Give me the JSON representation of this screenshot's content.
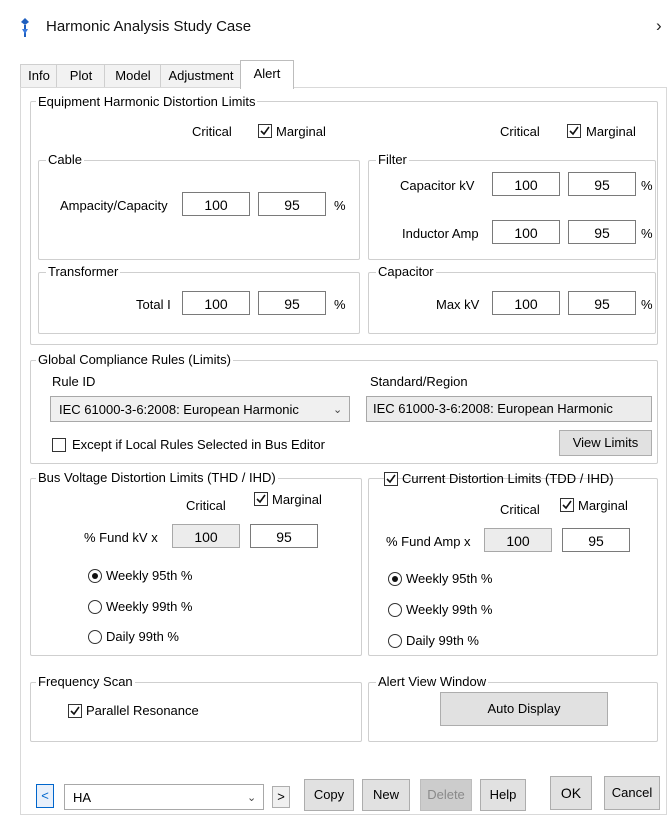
{
  "window": {
    "title": "Harmonic Analysis Study Case",
    "close_glyph": "›"
  },
  "tabs": [
    {
      "label": "Info"
    },
    {
      "label": "Plot"
    },
    {
      "label": "Model"
    },
    {
      "label": "Adjustment"
    },
    {
      "label": "Alert",
      "active": true
    }
  ],
  "equipment": {
    "legend": "Equipment Harmonic Distortion Limits",
    "critical_label": "Critical",
    "marginal_label": "Marginal",
    "marginal_checked": true,
    "cable": {
      "legend": "Cable",
      "rows": [
        {
          "label": "Ampacity/Capacity",
          "critical": "100",
          "marginal": "95",
          "unit": "%"
        }
      ]
    },
    "filter": {
      "legend": "Filter",
      "rows": [
        {
          "label": "Capacitor kV",
          "critical": "100",
          "marginal": "95",
          "unit": "%"
        },
        {
          "label": "Inductor Amp",
          "critical": "100",
          "marginal": "95",
          "unit": "%"
        }
      ]
    },
    "transformer": {
      "legend": "Transformer",
      "rows": [
        {
          "label": "Total I",
          "critical": "100",
          "marginal": "95",
          "unit": "%"
        }
      ]
    },
    "capacitor": {
      "legend": "Capacitor",
      "rows": [
        {
          "label": "Max kV",
          "critical": "100",
          "marginal": "95",
          "unit": "%"
        }
      ]
    }
  },
  "global": {
    "legend": "Global Compliance Rules (Limits)",
    "rule_id_label": "Rule ID",
    "rule_id_value": "IEC 61000-3-6:2008: European Harmonic",
    "standard_label": "Standard/Region",
    "standard_value": "IEC 61000-3-6:2008: European Harmonic",
    "except_label": "Except if Local Rules Selected in Bus Editor",
    "except_checked": false,
    "view_limits_label": "View Limits"
  },
  "bus_voltage": {
    "legend": "Bus Voltage Distortion Limits (THD / IHD)",
    "critical_label": "Critical",
    "marginal_label": "Marginal",
    "marginal_checked": true,
    "fund_label": "% Fund kV x",
    "critical_value": "100",
    "marginal_value": "95",
    "options": [
      {
        "label": "Weekly 95th %",
        "selected": true
      },
      {
        "label": "Weekly 99th %",
        "selected": false
      },
      {
        "label": "Daily 99th %",
        "selected": false
      }
    ]
  },
  "current": {
    "legend": "Current Distortion Limits (TDD / IHD)",
    "enabled_checked": true,
    "critical_label": "Critical",
    "marginal_label": "Marginal",
    "marginal_checked": true,
    "fund_label": "% Fund Amp x",
    "critical_value": "100",
    "marginal_value": "95",
    "options": [
      {
        "label": "Weekly 95th %",
        "selected": true
      },
      {
        "label": "Weekly 99th %",
        "selected": false
      },
      {
        "label": "Daily 99th %",
        "selected": false
      }
    ]
  },
  "frequency_scan": {
    "legend": "Frequency Scan",
    "parallel_label": "Parallel Resonance",
    "parallel_checked": true
  },
  "alert_view": {
    "legend": "Alert View Window",
    "auto_display_label": "Auto Display"
  },
  "footer": {
    "prev_glyph": "<",
    "next_glyph": ">",
    "study_case_value": "HA",
    "copy_label": "Copy",
    "new_label": "New",
    "delete_label": "Delete",
    "help_label": "Help",
    "ok_label": "OK",
    "cancel_label": "Cancel"
  },
  "colors": {
    "accent_blue": "#0066cc",
    "input_border": "#7a7a7a",
    "disabled_text": "#8a8a8a"
  }
}
